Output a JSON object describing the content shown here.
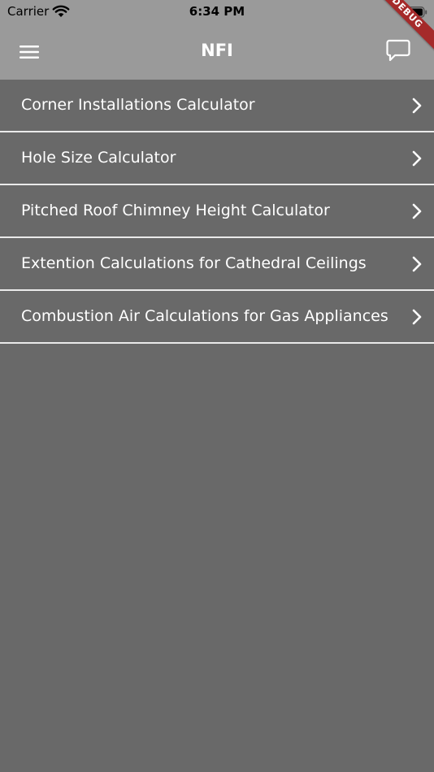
{
  "status_bar": {
    "carrier": "Carrier",
    "time": "6:34 PM",
    "wifi_icon": "wifi-icon",
    "battery_icon": "battery-icon"
  },
  "app_bar": {
    "title": "NFI",
    "menu_icon": "hamburger-menu-icon",
    "chat_icon": "chat-bubble-icon",
    "background": "#9a9a9a"
  },
  "debug_banner": "DEBUG",
  "list": {
    "background": "#696969",
    "divider_color": "#eaeaea",
    "items": [
      {
        "label": "Corner Installations Calculator"
      },
      {
        "label": "Hole Size Calculator"
      },
      {
        "label": "Pitched Roof Chimney Height Calculator"
      },
      {
        "label": "Extention Calculations for Cathedral Ceilings"
      },
      {
        "label": "Combustion Air Calculations for Gas Appliances"
      }
    ]
  }
}
